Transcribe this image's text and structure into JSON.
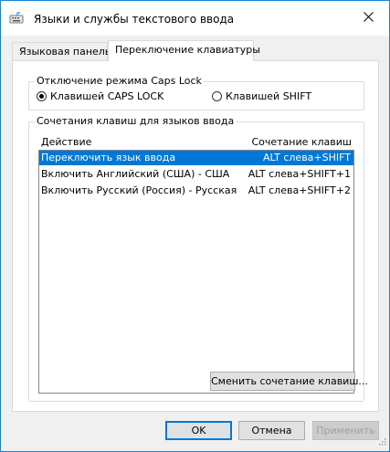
{
  "window": {
    "title": "Языки и службы текстового ввода",
    "icon": "keyboard-icon",
    "close_icon": "close-icon"
  },
  "tabs": [
    {
      "label": "Языковая панель",
      "selected": false
    },
    {
      "label": "Переключение клавиатуры",
      "selected": true
    }
  ],
  "caps_group": {
    "legend": "Отключение режима Caps Lock",
    "options": [
      {
        "label": "Клавишей CAPS LOCK",
        "checked": true
      },
      {
        "label": "Клавишей SHIFT",
        "checked": false
      }
    ]
  },
  "hotkeys_group": {
    "legend": "Сочетания клавиш для языков ввода",
    "columns": {
      "action": "Действие",
      "combo": "Сочетание клавиш"
    },
    "rows": [
      {
        "action": "Переключить язык ввода",
        "combo": "ALT слева+SHIFT",
        "selected": true
      },
      {
        "action": "Включить Английский (США) - США",
        "combo": "ALT слева+SHIFT+1",
        "selected": false
      },
      {
        "action": "Включить Русский (Россия) - Русская",
        "combo": "ALT слева+SHIFT+2",
        "selected": false
      }
    ],
    "change_button": "Сменить сочетание клавиш..."
  },
  "buttons": {
    "ok": "OK",
    "cancel": "Отмена",
    "apply": "Применить"
  },
  "colors": {
    "accent": "#0078d7",
    "window_border": "#1883d7"
  }
}
